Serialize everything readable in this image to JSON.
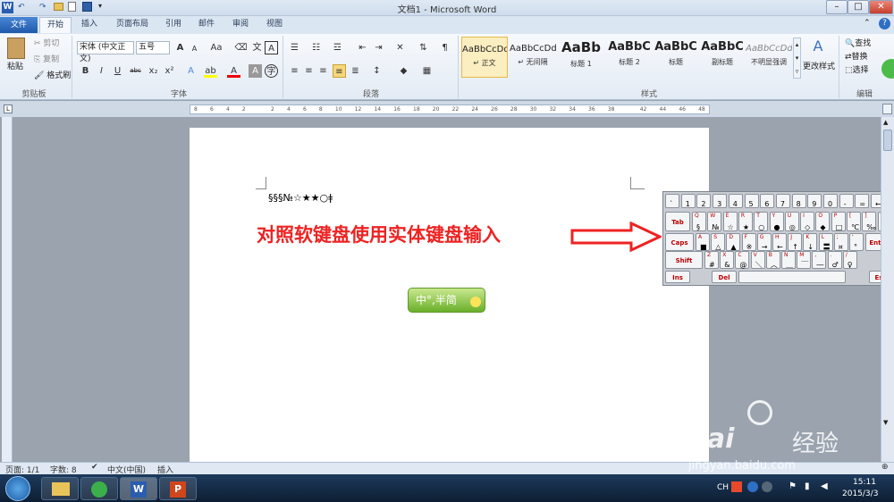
{
  "app": {
    "title": "文档1 - Microsoft Word",
    "icon": "W"
  },
  "window_buttons": {
    "minimize": "–",
    "restore": "□",
    "close": "✕"
  },
  "qat": {
    "undo": "↶",
    "redo": "↷"
  },
  "tabs": [
    "文件",
    "开始",
    "插入",
    "页面布局",
    "引用",
    "邮件",
    "审阅",
    "视图"
  ],
  "clipboard": {
    "paste": "粘贴",
    "cut": "剪切",
    "copy": "复制",
    "format_painter": "格式刷",
    "group": "剪贴板"
  },
  "font": {
    "name": "宋体 (中文正文)",
    "size": "五号",
    "group": "字体",
    "grow": "A",
    "shrink": "A",
    "aa": "Aa",
    "bold": "B",
    "italic": "I",
    "underline": "U",
    "strike": "abc",
    "sub": "x₂",
    "sup": "x²"
  },
  "paragraph": {
    "group": "段落"
  },
  "styles": {
    "group": "样式",
    "items": [
      {
        "preview": "AaBbCcDd",
        "name": "↵ 正文"
      },
      {
        "preview": "AaBbCcDd",
        "name": "↵ 无间隔"
      },
      {
        "preview": "AaBb",
        "name": "标题 1"
      },
      {
        "preview": "AaBbC",
        "name": "标题 2"
      },
      {
        "preview": "AaBbC",
        "name": "标题"
      },
      {
        "preview": "AaBbC",
        "name": "副标题"
      },
      {
        "preview": "AaBbCcDd",
        "name": "不明显强调"
      }
    ],
    "change": "更改样式"
  },
  "editing": {
    "group": "编辑",
    "find": "查找",
    "replace": "替换",
    "select": "选择"
  },
  "ruler": {
    "ticks": [
      "8",
      "6",
      "4",
      "2",
      "",
      "2",
      "4",
      "6",
      "8",
      "10",
      "12",
      "14",
      "16",
      "18",
      "20",
      "22",
      "24",
      "26",
      "28",
      "30",
      "32",
      "34",
      "36",
      "38",
      "",
      "42",
      "44",
      "46",
      "48"
    ]
  },
  "document": {
    "text": "§§§№☆★★○ǂ"
  },
  "annotation": {
    "text": "对照软键盘使用实体键盘输入",
    "color": "#e22222"
  },
  "ime": {
    "label": "中°,半简"
  },
  "keyboard": {
    "row1": [
      {
        "t": "",
        "b": "`"
      },
      {
        "t": "",
        "b": "1"
      },
      {
        "t": "",
        "b": "2"
      },
      {
        "t": "",
        "b": "3"
      },
      {
        "t": "",
        "b": "4"
      },
      {
        "t": "",
        "b": "5"
      },
      {
        "t": "",
        "b": "6"
      },
      {
        "t": "",
        "b": "7"
      },
      {
        "t": "",
        "b": "8"
      },
      {
        "t": "",
        "b": "9"
      },
      {
        "t": "",
        "b": "0"
      },
      {
        "t": "",
        "b": "-"
      },
      {
        "t": "",
        "b": "="
      },
      {
        "t": "",
        "b": "←"
      }
    ],
    "row2": [
      {
        "t": "Q",
        "b": "§"
      },
      {
        "t": "W",
        "b": "№"
      },
      {
        "t": "E",
        "b": "☆"
      },
      {
        "t": "R",
        "b": "★"
      },
      {
        "t": "T",
        "b": "○"
      },
      {
        "t": "Y",
        "b": "●"
      },
      {
        "t": "U",
        "b": "◎"
      },
      {
        "t": "I",
        "b": "◇"
      },
      {
        "t": "O",
        "b": "◆"
      },
      {
        "t": "P",
        "b": "□"
      },
      {
        "t": "[",
        "b": "℃"
      },
      {
        "t": "]",
        "b": "‰"
      },
      {
        "t": "\\",
        "b": "€"
      }
    ],
    "row3": [
      {
        "t": "A",
        "b": "■"
      },
      {
        "t": "S",
        "b": "△"
      },
      {
        "t": "D",
        "b": "▲"
      },
      {
        "t": "F",
        "b": "※"
      },
      {
        "t": "G",
        "b": "→"
      },
      {
        "t": "H",
        "b": "←"
      },
      {
        "t": "J",
        "b": "↑"
      },
      {
        "t": "K",
        "b": "↓"
      },
      {
        "t": "L",
        "b": "〓"
      },
      {
        "t": ";",
        "b": "¤"
      },
      {
        "t": "'",
        "b": "°"
      }
    ],
    "row4": [
      {
        "t": "Z",
        "b": "#"
      },
      {
        "t": "X",
        "b": "&"
      },
      {
        "t": "C",
        "b": "@"
      },
      {
        "t": "V",
        "b": "＼"
      },
      {
        "t": "B",
        "b": "︿"
      },
      {
        "t": "N",
        "b": "＿"
      },
      {
        "t": "M",
        "b": "￣"
      },
      {
        "t": ",",
        "b": "―"
      },
      {
        "t": ".",
        "b": "♂"
      },
      {
        "t": "/",
        "b": "♀"
      }
    ],
    "fn": {
      "tab": "Tab",
      "caps": "Caps",
      "shift": "Shift",
      "enter": "Enter",
      "ins": "Ins",
      "del": "Del",
      "esc": "Esc"
    }
  },
  "statusbar": {
    "page": "页面: 1/1",
    "words": "字数: 8",
    "lang": "中文(中国)",
    "mode": "插入"
  },
  "taskbar": {
    "time": "15:11",
    "date": "2015/3/3",
    "lang": "CH"
  },
  "watermark": {
    "brand": "Bai",
    "brand2": "经验",
    "url": "jingyan.baidu.com"
  }
}
